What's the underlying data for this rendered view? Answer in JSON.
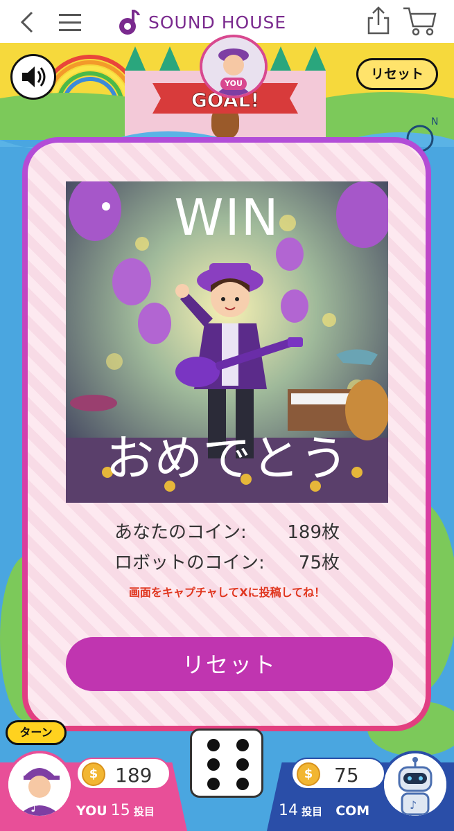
{
  "header": {
    "brand_name": "SOUND HOUSE",
    "back_icon": "back-chevron-icon",
    "menu_icon": "hamburger-menu-icon",
    "share_icon": "share-icon",
    "cart_icon": "cart-icon"
  },
  "board": {
    "sound_icon": "speaker-icon",
    "reset_top_label": "リセット",
    "you_tag": "YOU",
    "goal_banner": "GOAL!"
  },
  "modal": {
    "win_text": "WIN",
    "congrats_text": "おめでとう",
    "your_coins_label": "あなたのコイン:",
    "your_coins_value": "189枚",
    "robot_coins_label": "ロボットのコイン:",
    "robot_coins_value": "75枚",
    "capture_message": "画面をキャプチャしてXに投稿してね！",
    "reset_label": "リセット"
  },
  "footer": {
    "turn_label": "ターン",
    "you": {
      "coins": "189",
      "name": "YOU",
      "turn_count": "15",
      "turn_unit": "投目"
    },
    "com": {
      "coins": "75",
      "name": "COM",
      "turn_count": "14",
      "turn_unit": "投目"
    },
    "dice_value": 6
  },
  "colors": {
    "brand_purple": "#7a2a8e",
    "reset_button": "#c035b0",
    "capture_text": "#e0361f",
    "you_pink": "#e84f98",
    "com_blue": "#2a4ea8"
  }
}
